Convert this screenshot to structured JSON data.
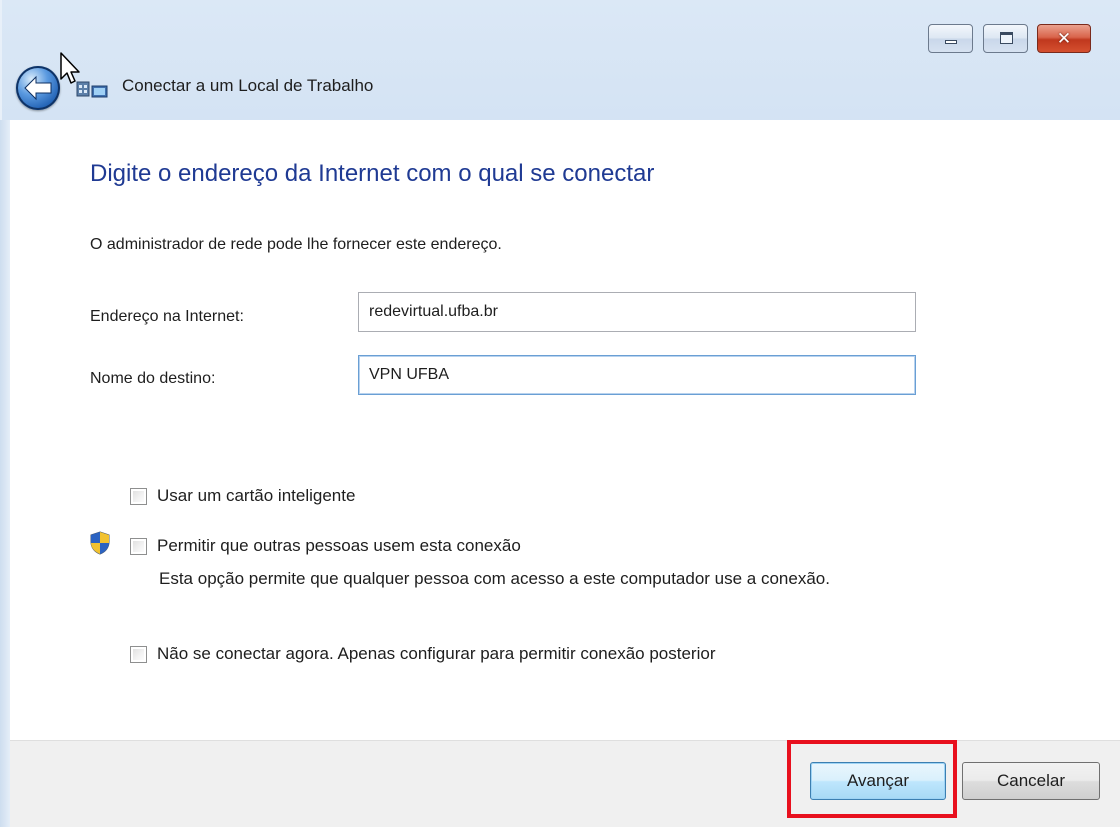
{
  "window": {
    "title": "Conectar a um Local de Trabalho",
    "controls": {
      "minimize_icon": "minimize-icon",
      "maximize_icon": "maximize-icon",
      "close_glyph": "✕"
    }
  },
  "page": {
    "heading": "Digite o endereço da Internet com o qual se conectar",
    "intro": "O administrador de rede pode lhe fornecer este endereço."
  },
  "form": {
    "address_label": "Endereço na Internet:",
    "address_value": "redevirtual.ufba.br",
    "destination_label": "Nome do destino:",
    "destination_value": "VPN UFBA"
  },
  "options": {
    "smartcard_label": "Usar um cartão inteligente",
    "smartcard_checked": false,
    "allow_others_label": "Permitir que outras pessoas usem esta conexão",
    "allow_others_checked": false,
    "allow_others_description": "Esta opção permite que qualquer pessoa com acesso a este computador use a conexão.",
    "dont_connect_label": "Não se conectar agora. Apenas configurar para permitir conexão posterior",
    "dont_connect_checked": false
  },
  "buttons": {
    "next_label": "Avançar",
    "cancel_label": "Cancelar"
  },
  "colors": {
    "heading": "#1f3a93",
    "highlight": "#e8101e",
    "frame": "#c9dbef"
  }
}
